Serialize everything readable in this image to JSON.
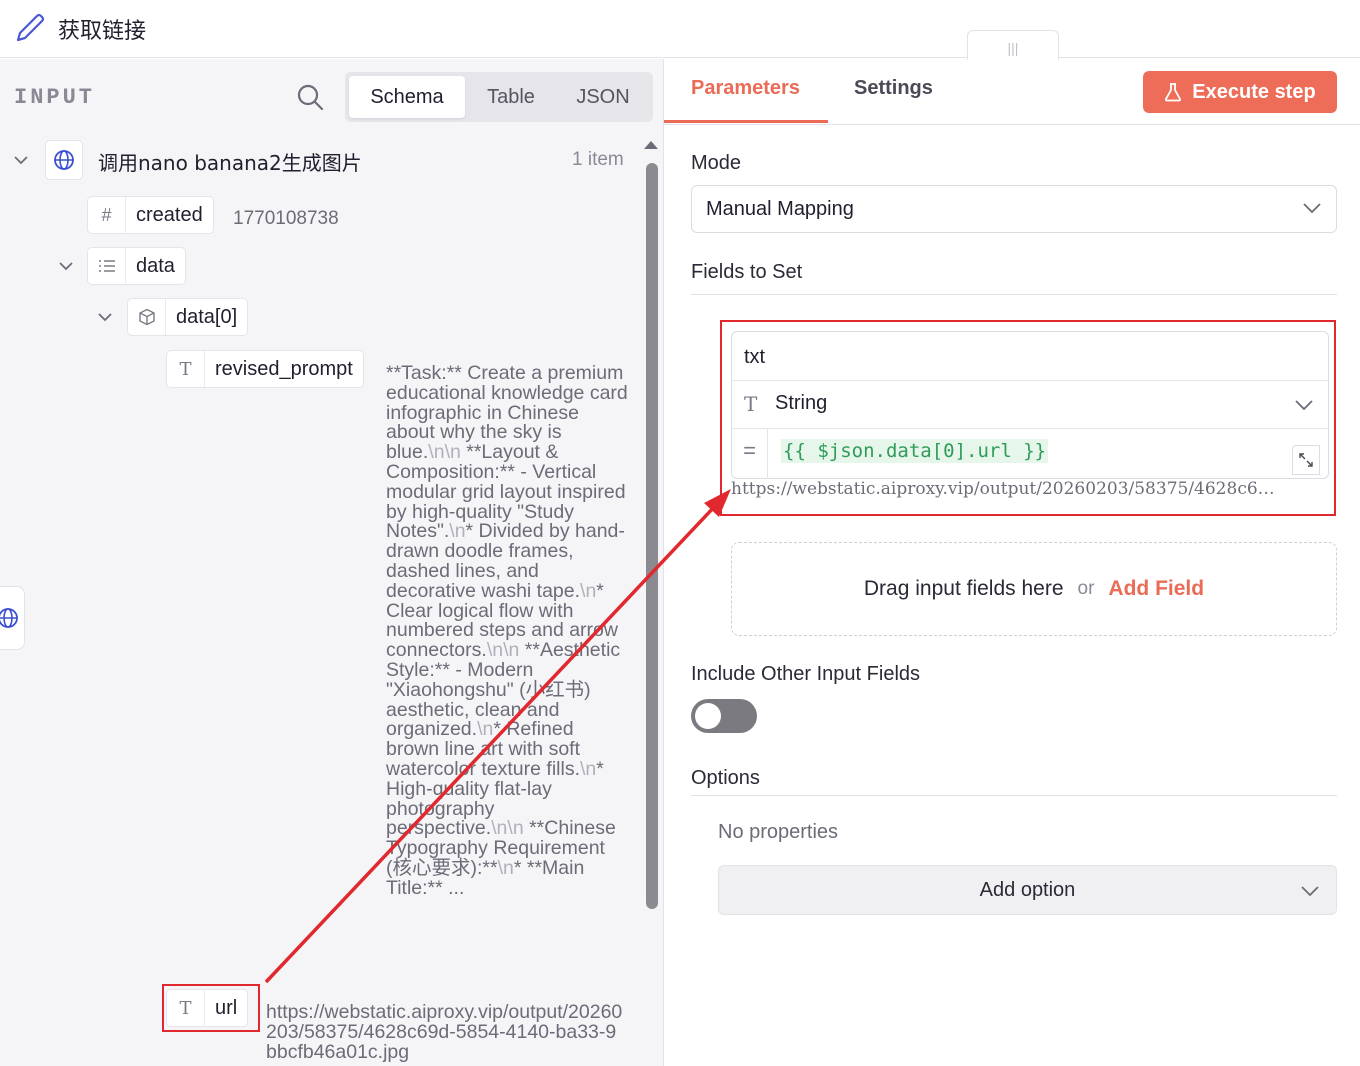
{
  "header": {
    "title": "获取链接",
    "handle_glyph": "|||"
  },
  "input_panel": {
    "label": "INPUT",
    "view_tabs": [
      "Schema",
      "Table",
      "JSON"
    ],
    "active_tab": "Schema",
    "node": {
      "name": "调用nano banana2生成图片",
      "count": "1 item",
      "icon": "globe-icon"
    },
    "fields": {
      "created": {
        "name": "created",
        "type_icon": "#",
        "value": "1770108738"
      },
      "data": {
        "name": "data",
        "type_icon": "list-icon"
      },
      "data0": {
        "name": "data[0]",
        "type_icon": "cube-icon"
      },
      "revised_prompt": {
        "name": "revised_prompt",
        "type_icon": "T",
        "value_parts": [
          "**Task:** Create a premium educational knowledge card infographic in Chinese about why the sky is blue.",
          "\\n",
          "\\n",
          " **Layout & Composition:** - Vertical modular grid layout inspired by high-quality \"Study Notes\".",
          "\\n",
          "* Divided by hand-drawn doodle frames, dashed lines, and decorative washi tape.",
          "\\n",
          "* Clear logical flow with numbered steps and arrow connectors.",
          "\\n",
          "\\n",
          " **Aesthetic Style:** - Modern \"Xiaohongshu\" (小红书) aesthetic, clean and organized.",
          "\\n",
          "* Refined brown line art with soft watercolor texture fills.",
          "\\n",
          "* High-quality flat-lay photography perspective.",
          "\\n",
          "\\n",
          " **Chinese Typography Requirement (核心要求):**",
          "\\n",
          "* **Main Title:** ..."
        ]
      },
      "url": {
        "name": "url",
        "type_icon": "T",
        "value": "https://webstatic.aiproxy.vip/output/20260203/58375/4628c69d-5854-4140-ba33-9bbcfb46a01c.jpg"
      }
    }
  },
  "params_panel": {
    "tabs": [
      "Parameters",
      "Settings"
    ],
    "active_tab": "Parameters",
    "execute_label": "Execute step",
    "mode_label": "Mode",
    "mode_value": "Manual Mapping",
    "fields_to_set_label": "Fields to Set",
    "field": {
      "name": "txt",
      "type": "String",
      "expression": "{{ $json.data[0].url }}",
      "preview": "https://webstatic.aiproxy.vip/output/20260203/58375/4628c6…"
    },
    "dropzone": {
      "hint": "Drag input fields here",
      "or": "or",
      "add_field": "Add Field"
    },
    "include_other_label": "Include Other Input Fields",
    "include_other_value": false,
    "options_label": "Options",
    "no_properties": "No properties",
    "add_option_label": "Add option"
  },
  "colors": {
    "accent": "#ea6c57",
    "execute_bg": "#ee6d59",
    "annotation_red": "#e0282e",
    "expression_green": "#2f9c5a",
    "panel_bg": "#f5f5f7"
  }
}
